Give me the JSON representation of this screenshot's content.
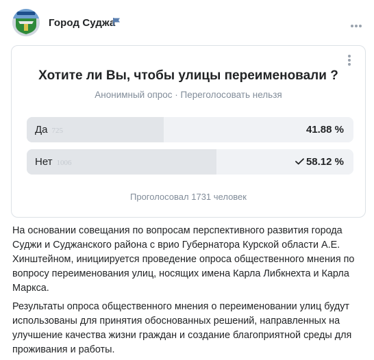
{
  "post": {
    "author": "Город Суджа",
    "flag_icon": "flag-icon",
    "more_icon": "more-horizontal-icon"
  },
  "poll": {
    "title": "Хотите ли Вы, чтобы улицы переименовали ?",
    "subtitle": "Анонимный опрос · Переголосовать нельзя",
    "options": [
      {
        "label": "Да",
        "count": "725",
        "percent": "41.88 %",
        "share": 41.88,
        "selected": false
      },
      {
        "label": "Нет",
        "count": "1006",
        "percent": "58.12 %",
        "share": 58.12,
        "selected": true
      }
    ],
    "total": "Проголосовал 1731 человек",
    "colors": {
      "fill": "#e2e5e9",
      "track": "#f0f2f5",
      "muted": "#818c99"
    }
  },
  "text": {
    "paragraph1_lines": [
      "На основании совещания по вопросам перспективного развития города",
      "Суджи и Суджанского района с врио Губернатора Курской области А.Е.",
      "Хинштейном, инициируется проведение опроса общественного мнения по",
      "вопросу переименования улиц, носящих имена Карла Либкнехта и Карла",
      "Маркса."
    ],
    "paragraph2_lines": [
      "Результаты опроса общественного мнения о переименовании улиц будут",
      "использованы для принятия обоснованных решений, направленных на",
      "улучшение качества жизни граждан и создание благоприятной среды для",
      "проживания и работы."
    ]
  }
}
